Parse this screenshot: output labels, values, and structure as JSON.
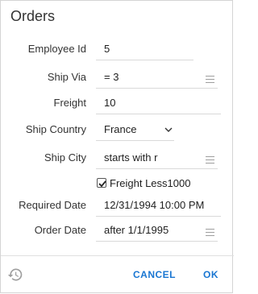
{
  "dialog": {
    "title": "Orders"
  },
  "fields": {
    "employee_id": {
      "label": "Employee Id",
      "value": "5"
    },
    "ship_via": {
      "label": "Ship Via",
      "value": "= 3"
    },
    "freight": {
      "label": "Freight",
      "value": "10"
    },
    "ship_country": {
      "label": "Ship Country",
      "value": "France"
    },
    "ship_city": {
      "label": "Ship City",
      "value": "starts with r"
    },
    "freight_less": {
      "label": "Freight Less1000",
      "checked": true
    },
    "required_date": {
      "label": "Required Date",
      "value": "12/31/1994 10:00 PM"
    },
    "order_date": {
      "label": "Order Date",
      "value": "after 1/1/1995"
    }
  },
  "footer": {
    "cancel_label": "CANCEL",
    "ok_label": "OK"
  },
  "colors": {
    "accent": "#1976d2",
    "underline": "#d9d9d9",
    "icon": "#9e9e9e"
  }
}
